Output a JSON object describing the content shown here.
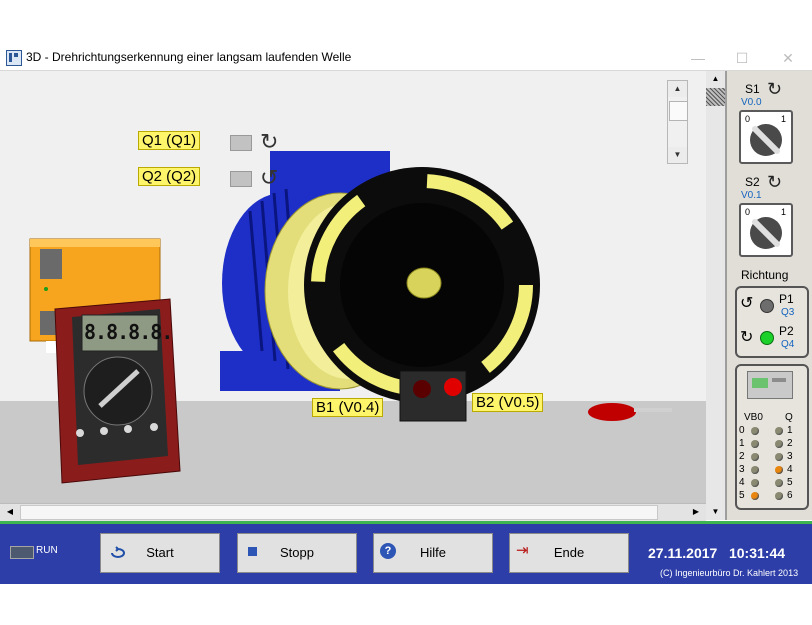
{
  "window": {
    "title": "3D - Drehrichtungserkennung einer langsam laufenden Welle",
    "minimize": "—",
    "maximize": "☐",
    "close": "✕"
  },
  "scene": {
    "q1_label": "Q1 (Q1)",
    "q2_label": "Q2 (Q2)",
    "b1_label": "B1 (V0.4)",
    "b2_label": "B2 (V0.5)",
    "multimeter_display": "8.8.8.8."
  },
  "panel": {
    "s1": {
      "label": "S1",
      "var": "V0.0",
      "pos_0": "0",
      "pos_1": "1"
    },
    "s2": {
      "label": "S2",
      "var": "V0.1",
      "pos_0": "0",
      "pos_1": "1"
    },
    "richtung": "Richtung",
    "p1": {
      "label": "P1",
      "var": "Q3"
    },
    "p2": {
      "label": "P2",
      "var": "Q4"
    },
    "plc": {
      "col_in": "VB0",
      "col_out": "Q",
      "rows": [
        {
          "in": "0",
          "out": "1"
        },
        {
          "in": "1",
          "out": "2"
        },
        {
          "in": "2",
          "out": "3"
        },
        {
          "in": "3",
          "out": "4"
        },
        {
          "in": "4",
          "out": "5"
        },
        {
          "in": "5",
          "out": "6"
        }
      ]
    }
  },
  "bottom": {
    "run_label": "RUN",
    "start": "Start",
    "stopp": "Stopp",
    "hilfe": "Hilfe",
    "ende": "Ende",
    "date": "27.11.2017",
    "time": "10:31:44",
    "copyright": "(C) Ingenieurbüro Dr. Kahlert 2013"
  },
  "colors": {
    "bottom_bar": "#2d3ea8",
    "accent_green": "#3fb54f",
    "label_yellow": "#fff56b",
    "motor_blue": "#1e2fc8"
  }
}
